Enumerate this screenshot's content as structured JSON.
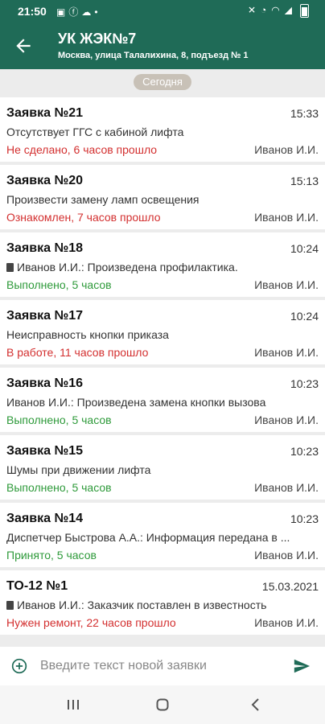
{
  "status_bar": {
    "time": "21:50",
    "left_icons": [
      "gallery-icon",
      "facebook-icon",
      "cloud-icon",
      "dot-icon"
    ],
    "right_icons": [
      "mute-icon",
      "alarm-icon",
      "wifi-icon",
      "signal-icon",
      "battery-icon"
    ]
  },
  "header": {
    "title": "УК ЖЭК№7",
    "subtitle": "Москва, улица Талалихина, 8, подъезд № 1"
  },
  "date_divider": "Сегодня",
  "tickets": [
    {
      "title": "Заявка №21",
      "time": "15:33",
      "description": "Отсутствует ГГС с кабиной лифта",
      "has_attachment": false,
      "status": "Не сделано, 6 часов прошло",
      "status_color": "#d32f2f",
      "assignee": "Иванов И.И."
    },
    {
      "title": "Заявка №20",
      "time": "15:13",
      "description": "Произвести замену ламп освещения",
      "has_attachment": false,
      "status": "Ознакомлен, 7 часов прошло",
      "status_color": "#d32f2f",
      "assignee": "Иванов И.И."
    },
    {
      "title": "Заявка №18",
      "time": "10:24",
      "description": "Иванов И.И.: Произведена профилактика.",
      "has_attachment": true,
      "status": "Выполнено, 5 часов",
      "status_color": "#2e9a3a",
      "assignee": "Иванов И.И."
    },
    {
      "title": "Заявка №17",
      "time": "10:24",
      "description": "Неисправность кнопки приказа",
      "has_attachment": false,
      "status": "В работе, 11 часов прошло",
      "status_color": "#d32f2f",
      "assignee": "Иванов И.И."
    },
    {
      "title": "Заявка №16",
      "time": "10:23",
      "description": "Иванов И.И.: Произведена замена кнопки вызова",
      "has_attachment": false,
      "status": "Выполнено, 5 часов",
      "status_color": "#2e9a3a",
      "assignee": "Иванов И.И."
    },
    {
      "title": "Заявка №15",
      "time": "10:23",
      "description": "Шумы при движении лифта",
      "has_attachment": false,
      "status": "Выполнено, 5 часов",
      "status_color": "#2e9a3a",
      "assignee": "Иванов И.И."
    },
    {
      "title": "Заявка №14",
      "time": "10:23",
      "description": "Диспетчер Быстрова А.А.: Информация передана в ...",
      "has_attachment": false,
      "status": "Принято, 5 часов",
      "status_color": "#2e9a3a",
      "assignee": "Иванов И.И."
    },
    {
      "title": "ТО-12 №1",
      "time": "15.03.2021",
      "description": "Иванов И.И.: Заказчик поставлен в известность",
      "has_attachment": true,
      "status": "Нужен ремонт, 22 часов прошло",
      "status_color": "#d32f2f",
      "assignee": "Иванов И.И."
    }
  ],
  "input": {
    "placeholder": "Введите текст новой заявки"
  },
  "colors": {
    "brand": "#1f6b57",
    "status_red": "#d32f2f",
    "status_green": "#2e9a3a"
  }
}
